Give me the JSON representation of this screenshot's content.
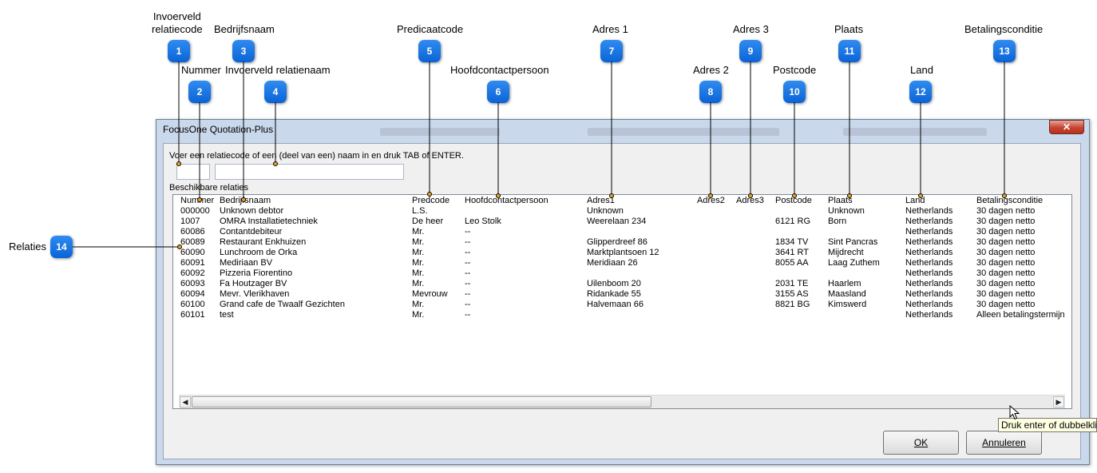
{
  "annotations": [
    {
      "n": "1",
      "label": "Invoerveld\nrelatiecode"
    },
    {
      "n": "2",
      "label": "Nummer"
    },
    {
      "n": "3",
      "label": "Bedrijfsnaam"
    },
    {
      "n": "4",
      "label": "Invoerveld relatienaam"
    },
    {
      "n": "5",
      "label": "Predicaatcode"
    },
    {
      "n": "6",
      "label": "Hoofdcontactpersoon"
    },
    {
      "n": "7",
      "label": "Adres 1"
    },
    {
      "n": "8",
      "label": "Adres 2"
    },
    {
      "n": "9",
      "label": "Adres 3"
    },
    {
      "n": "10",
      "label": "Postcode"
    },
    {
      "n": "11",
      "label": "Plaats"
    },
    {
      "n": "12",
      "label": "Land"
    },
    {
      "n": "13",
      "label": "Betalingsconditie"
    },
    {
      "n": "14",
      "label": "Relaties"
    }
  ],
  "window": {
    "title": "FocusOne Quotation-Plus",
    "close_glyph": "✕"
  },
  "dialog": {
    "instruction": "Voer een relatiecode of een (deel van een) naam in en druk TAB of ENTER.",
    "code_value": "",
    "name_value": "",
    "section_label": "Beschikbare relaties"
  },
  "table": {
    "columns": [
      "Nummer",
      "Bedrijfsnaam",
      "Predcode",
      "Hoofdcontactpersoon",
      "Adres1",
      "Adres2",
      "Adres3",
      "Postcode",
      "Plaats",
      "Land",
      "Betalingsconditie"
    ],
    "rows": [
      [
        "000000",
        "Unknown debtor",
        "L.S.",
        "",
        "Unknown",
        "",
        "",
        "",
        "Unknown",
        "Netherlands",
        "30 dagen netto"
      ],
      [
        "1007",
        "OMRA Installatietechniek",
        "De heer",
        "Leo Stolk",
        "Weerelaan 234",
        "",
        "",
        "6121 RG",
        "Born",
        "Netherlands",
        "30 dagen netto"
      ],
      [
        "60086",
        "Contantdebiteur",
        "Mr.",
        "--",
        "",
        "",
        "",
        "",
        "",
        "Netherlands",
        "30 dagen netto"
      ],
      [
        "60089",
        "Restaurant Enkhuizen",
        "Mr.",
        "--",
        "Glipperdreef 86",
        "",
        "",
        "1834 TV",
        "Sint Pancras",
        "Netherlands",
        "30 dagen netto"
      ],
      [
        "60090",
        "Lunchroom de Orka",
        "Mr.",
        "--",
        "Marktplantsoen 12",
        "",
        "",
        "3641 RT",
        "Mijdrecht",
        "Netherlands",
        "30 dagen netto"
      ],
      [
        "60091",
        "Mediriaan BV",
        "Mr.",
        "--",
        "Meridiaan 26",
        "",
        "",
        "8055 AA",
        "Laag Zuthem",
        "Netherlands",
        "30 dagen netto"
      ],
      [
        "60092",
        "Pizzeria Fiorentino",
        "Mr.",
        "--",
        "",
        "",
        "",
        "",
        "",
        "Netherlands",
        "30 dagen netto"
      ],
      [
        "60093",
        "Fa Houtzager BV",
        "Mr.",
        "--",
        "Uilenboom 20",
        "",
        "",
        "2031 TE",
        "Haarlem",
        "Netherlands",
        "30 dagen netto"
      ],
      [
        "60094",
        "Mevr. Vlerikhaven",
        "Mevrouw",
        "--",
        "Ridankade 55",
        "",
        "",
        "3155 AS",
        "Maasland",
        "Netherlands",
        "30 dagen netto"
      ],
      [
        "60100",
        "Grand cafe de Twaalf Gezichten",
        "Mr.",
        "--",
        "Halvemaan 66",
        "",
        "",
        "8821 BG",
        "Kimswerd",
        "Netherlands",
        "30 dagen netto"
      ],
      [
        "60101",
        "test",
        "Mr.",
        "--",
        "",
        "",
        "",
        "",
        "",
        "Netherlands",
        "Alleen betalingstermijn"
      ]
    ]
  },
  "scrollbar": {
    "left_arrow": "◀",
    "right_arrow": "▶"
  },
  "buttons": {
    "ok": "OK",
    "cancel": "Annuleren"
  },
  "tooltip": "Druk enter of dubbelklik"
}
